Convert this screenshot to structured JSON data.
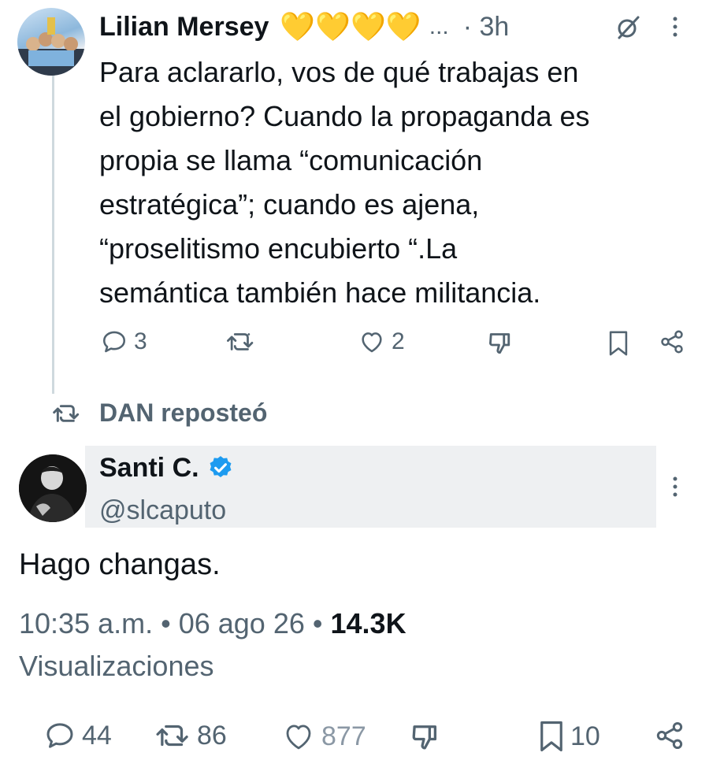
{
  "reply": {
    "author_name": "Lilian Mersey",
    "hearts": [
      "💛",
      "💛",
      "💛",
      "💛"
    ],
    "ellipsis": "...",
    "time": "· 3h",
    "text": "Para aclararlo, vos de qué trabajas en el gobierno? Cuando la propaganda es propia se llama “comunicación estratégica”; cuando es ajena, “proselitismo encubierto “.La semántica también hace militancia.",
    "lines": [
      "Para aclararlo, vos de qué trabajas en",
      "el gobierno? Cuando la propaganda es",
      "propia se llama “comunicación",
      "estratégica”; cuando es ajena,",
      "“proselitismo encubierto “.La",
      "semántica también hace militancia."
    ],
    "actions": {
      "replies": "3",
      "reposts": "",
      "likes": "2"
    }
  },
  "repost_banner": {
    "label": "DAN reposteó"
  },
  "main": {
    "author_name": "Santi C.",
    "handle": "@slcaputo",
    "text": "Hago changas.",
    "timestamp": "10:35 a.m. • 06 ago 26 •",
    "views_count": "14.3K",
    "views_label": "Visualizaciones",
    "actions": {
      "replies": "44",
      "reposts": "86",
      "likes": "877",
      "bookmarks": "10"
    }
  },
  "colors": {
    "text": "#0f1419",
    "muted": "#536471",
    "verified": "#1d9bf0",
    "heart": "#f5c518"
  },
  "icons": [
    "more-icon",
    "grok-icon",
    "reply-icon",
    "repost-icon",
    "like-icon",
    "dislike-icon",
    "bookmark-icon",
    "share-icon",
    "verified-badge-icon"
  ]
}
